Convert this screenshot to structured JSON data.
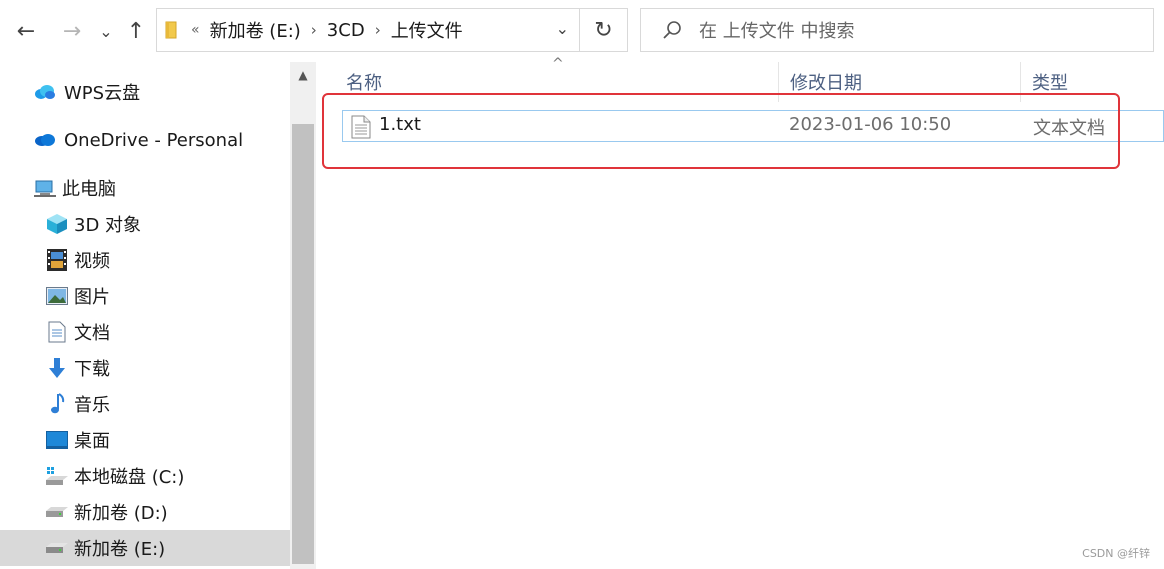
{
  "nav": {
    "back": "←",
    "forward": "→",
    "recent": "⌄",
    "up": "↑",
    "refresh": "↻"
  },
  "address": {
    "overflow": "«",
    "crumbs": [
      "新加卷 (E:)",
      "3CD",
      "上传文件"
    ],
    "separator": "›",
    "dropdown": "⌄"
  },
  "search": {
    "placeholder": "在 上传文件 中搜索"
  },
  "sidebar": {
    "items": [
      {
        "label": "WPS云盘",
        "icon": "cloud-icon"
      },
      {
        "label": "OneDrive - Personal",
        "icon": "onedrive-icon"
      },
      {
        "label": "此电脑",
        "icon": "computer-icon"
      },
      {
        "label": "3D 对象",
        "icon": "cube-icon"
      },
      {
        "label": "视频",
        "icon": "film-icon"
      },
      {
        "label": "图片",
        "icon": "picture-icon"
      },
      {
        "label": "文档",
        "icon": "document-icon"
      },
      {
        "label": "下载",
        "icon": "download-icon"
      },
      {
        "label": "音乐",
        "icon": "music-icon"
      },
      {
        "label": "桌面",
        "icon": "desktop-icon"
      },
      {
        "label": "本地磁盘 (C:)",
        "icon": "drive-icon"
      },
      {
        "label": "新加卷 (D:)",
        "icon": "drive-icon"
      },
      {
        "label": "新加卷 (E:)",
        "icon": "drive-icon",
        "selected": true
      }
    ]
  },
  "scrollbar": {
    "up": "▲"
  },
  "columns": {
    "name": "名称",
    "modified": "修改日期",
    "type": "类型",
    "sort_indicator": "^"
  },
  "files": [
    {
      "name": "1.txt",
      "modified": "2023-01-06 10:50",
      "type": "文本文档"
    }
  ],
  "watermark": "CSDN @纤锌",
  "colors": {
    "accent": "#0078d4",
    "highlight": "#e0343a",
    "selection_border": "#99c9ef",
    "header_text": "#4d6082"
  }
}
